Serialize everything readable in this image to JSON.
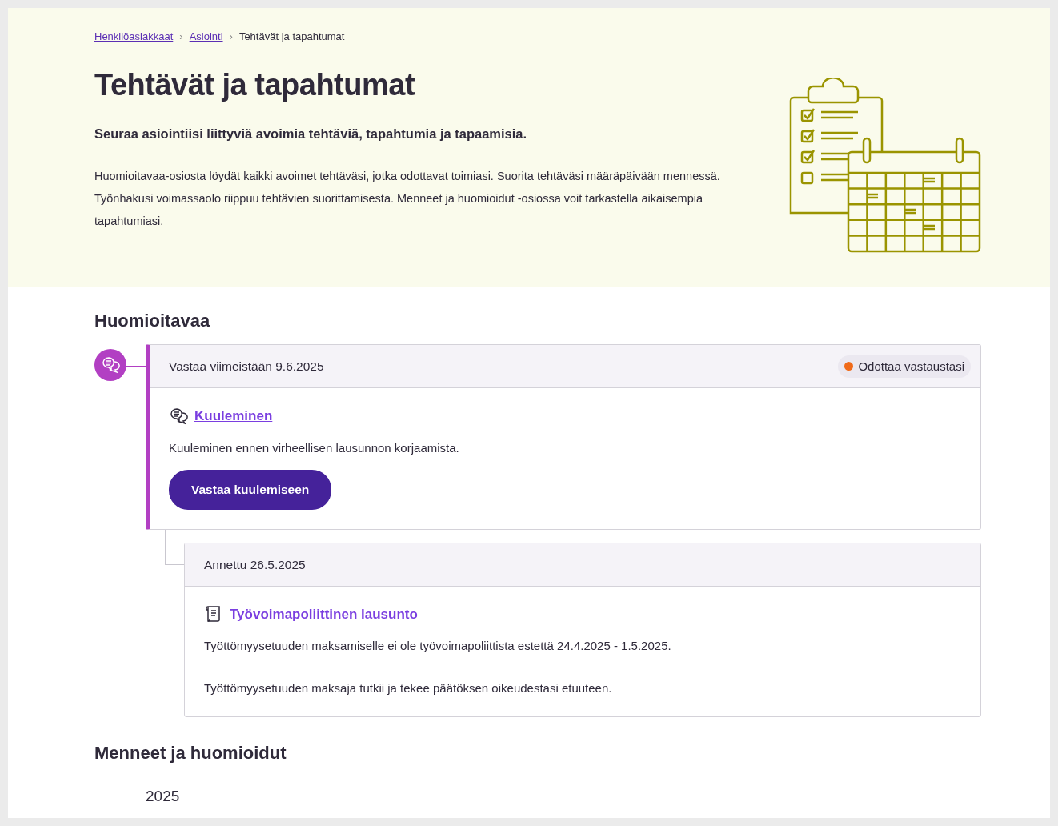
{
  "breadcrumb": [
    {
      "label": "Henkilöasiakkaat",
      "kind": "link"
    },
    {
      "separator": "›",
      "label": "Asiointi",
      "kind": "link"
    },
    {
      "separator": "›",
      "label": "Tehtävät ja tapahtumat",
      "kind": "current"
    }
  ],
  "header": {
    "title": "Tehtävät ja tapahtumat",
    "lead": "Seuraa asiointiisi liittyviä avoimia tehtäviä, tapahtumia ja tapaamisia.",
    "description": "Huomioitavaa-osiosta löydät kaikki avoimet tehtäväsi, jotka odottavat toimiasi. Suorita tehtäväsi määräpäivään mennessä. Työnhakusi voimassaolo riippuu tehtävien suorittamisesta. Menneet ja huomioidut -osiossa voit tarkastella aikaisempia tapahtumiasi."
  },
  "attention": {
    "heading": "Huomioitavaa",
    "task": {
      "deadline": "Vastaa viimeistään 9.6.2025",
      "status": {
        "label": "Odottaa vastaustasi",
        "color": "#f06a19"
      },
      "title": "Kuuleminen",
      "description": "Kuuleminen ennen virheellisen lausunnon korjaamista.",
      "button": "Vastaa kuulemiseen"
    },
    "related": {
      "date": "Annettu 26.5.2025",
      "title": "Työvoimapoliittinen lausunto",
      "paragraphs": [
        "Työttömyysetuuden maksamiselle ei ole työvoimapoliittista estettä 24.4.2025 - 1.5.2025.",
        "Työttömyysetuuden maksaja tutkii ja tekee päätöksen oikeudestasi etuuteen."
      ]
    }
  },
  "past": {
    "heading": "Menneet ja huomioidut",
    "year": "2025"
  }
}
